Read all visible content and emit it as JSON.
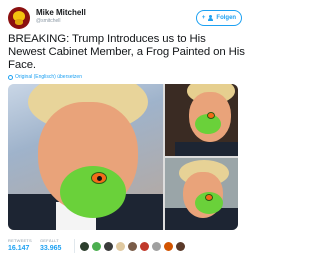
{
  "author": {
    "name": "Mike Mitchell",
    "handle": "@smitchell"
  },
  "follow_button": {
    "label": "Folgen"
  },
  "tweet": {
    "text": "BREAKING: Trump Introduces us to His Newest Cabinet Member, a Frog Painted on His Face.",
    "translate_label": "Original (Englisch) übersetzen"
  },
  "stats": {
    "retweets_label": "RETWEETS",
    "retweets_value": "16.147",
    "likes_label": "GEFÄLLT",
    "likes_value": "33.965"
  },
  "colors": {
    "accent": "#1da1f2",
    "frog": "#6ad13a",
    "frog_eye": "#f26b1a"
  },
  "liker_colors": [
    "#2c3e2d",
    "#4caf50",
    "#3b3b3b",
    "#e0c9a0",
    "#7a5c48",
    "#c0392b",
    "#a0a0a0",
    "#d35400",
    "#5b3a2a"
  ]
}
